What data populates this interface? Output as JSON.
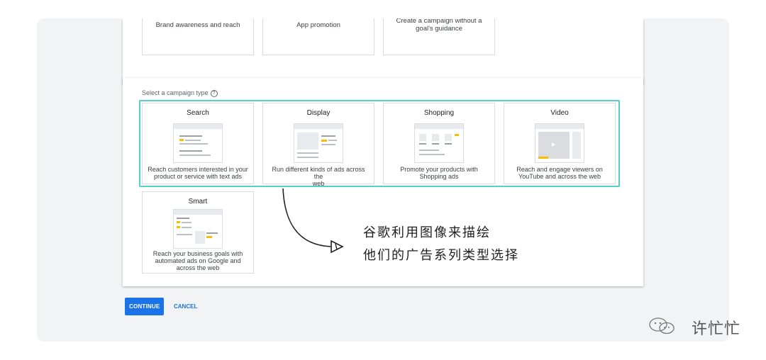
{
  "goals": [
    {
      "label": "Brand awareness and reach"
    },
    {
      "label": "App promotion"
    },
    {
      "label_lines": [
        "Create a campaign without a",
        "goal's guidance"
      ]
    }
  ],
  "campaign_type": {
    "label": "Select a campaign type",
    "help_icon": "?",
    "tiles": [
      {
        "title": "Search",
        "desc_lines": [
          "Reach customers interested in your",
          "product or service with text ads"
        ]
      },
      {
        "title": "Display",
        "desc_lines": [
          "Run different kinds of ads across the",
          "web"
        ]
      },
      {
        "title": "Shopping",
        "desc_lines": [
          "Promote your products with",
          "Shopping ads"
        ]
      },
      {
        "title": "Video",
        "desc_lines": [
          "Reach and engage viewers on",
          "YouTube and across the web"
        ]
      },
      {
        "title": "Smart",
        "desc_lines": [
          "Reach your business goals with",
          "automated ads on Google and",
          "across the web"
        ]
      }
    ]
  },
  "actions": {
    "continue": "CONTINUE",
    "cancel": "CANCEL"
  },
  "annotation": {
    "line1": "谷歌利用图像来描绘",
    "line2": "他们的广告系列类型选择"
  },
  "watermark": "许忙忙",
  "colors": {
    "primary": "#1a73e8",
    "selected_outline": "#55d0c6",
    "accent_yellow": "#fbbc04"
  }
}
